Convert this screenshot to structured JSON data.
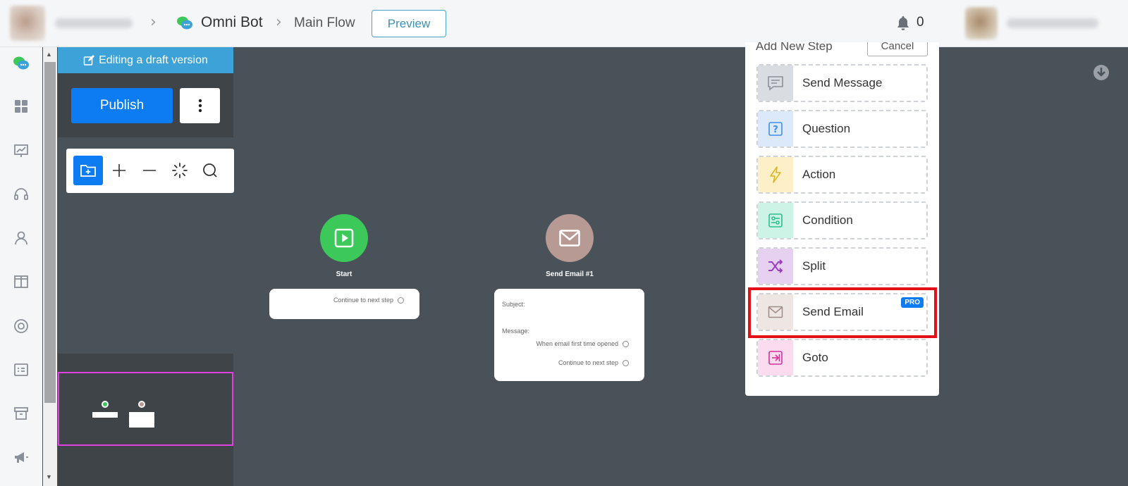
{
  "header": {
    "bot_name": "Omni Bot",
    "flow_name": "Main Flow",
    "preview_label": "Preview",
    "notification_count": "0"
  },
  "left_panel": {
    "draft_label": "Editing a draft version",
    "publish_label": "Publish"
  },
  "canvas": {
    "start_node": {
      "label": "Start",
      "continue_label": "Continue to next step",
      "color": "#3cc95a"
    },
    "email_node": {
      "label": "Send Email #1",
      "subject_label": "Subject:",
      "message_label": "Message:",
      "opened_label": "When email first time opened",
      "continue_label": "Continue to next step",
      "color": "#b89a94"
    }
  },
  "add_step": {
    "title": "Add New Step",
    "cancel_label": "Cancel",
    "pro_label": "PRO",
    "steps": [
      {
        "label": "Send Message",
        "icon": "message-icon",
        "bg": "#d9dce1"
      },
      {
        "label": "Question",
        "icon": "question-icon",
        "bg": "#dbe9fb"
      },
      {
        "label": "Action",
        "icon": "lightning-icon",
        "bg": "#fdf0c8"
      },
      {
        "label": "Condition",
        "icon": "condition-icon",
        "bg": "#cdf3e6"
      },
      {
        "label": "Split",
        "icon": "shuffle-icon",
        "bg": "#e6d2f0"
      },
      {
        "label": "Send Email",
        "icon": "envelope-icon",
        "bg": "#eee6e2",
        "pro": true
      },
      {
        "label": "Goto",
        "icon": "goto-icon",
        "bg": "#fbdcef"
      }
    ]
  },
  "colors": {
    "accent": "#0d7cf2",
    "draft": "#3da2d8",
    "canvas": "#4a5259",
    "highlight": "#e3101a"
  }
}
